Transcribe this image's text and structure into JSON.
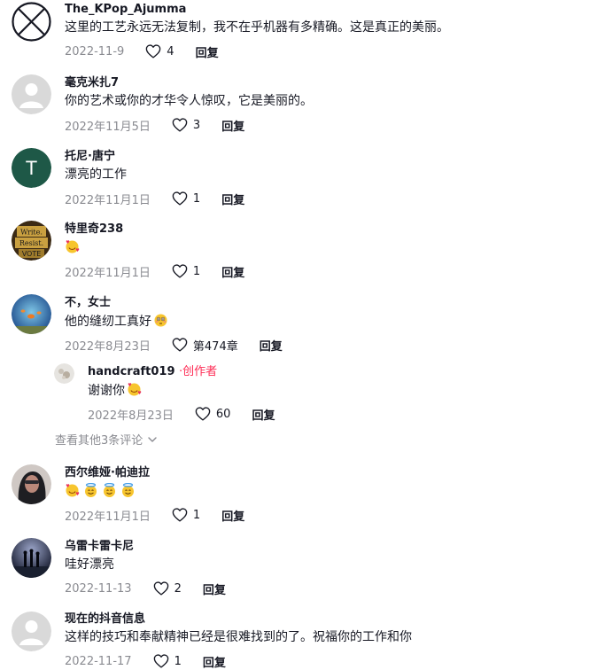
{
  "comments": [
    {
      "username": "The_KPop_Ajumma",
      "text": "这里的工艺永远无法复制，我不在乎机器有多精确。这是真正的美丽。",
      "date": "2022-11-9",
      "likes": "4",
      "reply": "回复",
      "avatar": "circle-x-icon"
    },
    {
      "username": "毫克米扎7",
      "text": "你的艺术或你的才华令人惊叹，它是美丽的。",
      "date": "2022年11月5日",
      "likes": "3",
      "reply": "回复",
      "avatar": "default-avatar"
    },
    {
      "username": "托尼·唐宁",
      "text": "漂亮的工作",
      "date": "2022年11月1日",
      "likes": "1",
      "reply": "回复",
      "avatar": "letter-avatar",
      "avatar_letter": "T",
      "avatar_color": "#1e5847"
    },
    {
      "username": "特里奇238",
      "text": "",
      "date": "2022年11月1日",
      "likes": "1",
      "reply": "回复",
      "avatar": "photo-avatar",
      "avatar_text": [
        "Write.",
        "Resist.",
        "VOTE"
      ],
      "emojis": [
        "smiling-face-with-hearts"
      ]
    },
    {
      "username": "不，女士",
      "text": "他的缝纫工真好",
      "date": "2022年8月23日",
      "likes": "第474章",
      "reply": "回复",
      "avatar": "photo-avatar",
      "emojis": [
        "flushed-face"
      ]
    },
    {
      "username": "西尔维娅·帕迪拉",
      "text": "",
      "date": "2022年11月1日",
      "likes": "1",
      "reply": "回复",
      "avatar": "photo-avatar",
      "emojis": [
        "smiling-face-with-hearts",
        "smiling-face-with-halo",
        "smiling-face-with-halo",
        "smiling-face-with-halo"
      ]
    },
    {
      "username": "乌雷卡雷卡尼",
      "text": "哇好漂亮",
      "date": "2022-11-13",
      "likes": "2",
      "reply": "回复",
      "avatar": "photo-avatar"
    },
    {
      "username": "现在的抖音信息",
      "text": "这样的技巧和奉献精神已经是很难找到的了。祝福你的工作和你",
      "date": "2022-11-17",
      "likes": "1",
      "reply": "回复",
      "avatar": "default-avatar"
    }
  ],
  "creator_reply": {
    "username": "handcraft019",
    "badge": "·创作者",
    "text": "谢谢你",
    "date": "2022年8月23日",
    "likes": "60",
    "reply": "回复",
    "avatar": "photo-avatar",
    "emojis": [
      "smiling-face-with-hearts"
    ]
  },
  "view_more": "查看其他3条评论",
  "colors": {
    "text": "#161823",
    "muted": "#8a8b91",
    "creator": "#fe2c55"
  }
}
